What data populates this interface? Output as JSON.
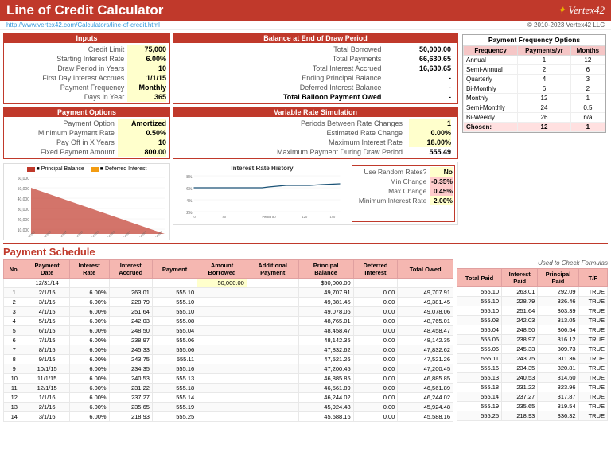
{
  "header": {
    "title": "Line of Credit Calculator",
    "link": "http://www.vertex42.com/Calculators/line-of-credit.html",
    "logo": "✦ Vertex42",
    "copyright": "© 2010-2023 Vertex42 LLC"
  },
  "inputs": {
    "title": "Inputs",
    "fields": [
      {
        "label": "Credit Limit",
        "value": "75,000"
      },
      {
        "label": "Starting Interest Rate",
        "value": "6.00%"
      },
      {
        "label": "Draw Period in Years",
        "value": "10"
      },
      {
        "label": "First Day Interest Accrues",
        "value": "1/1/15"
      },
      {
        "label": "Payment Frequency",
        "value": "Monthly"
      },
      {
        "label": "Days in Year",
        "value": "365"
      }
    ]
  },
  "balance": {
    "title": "Balance at End of Draw Period",
    "fields": [
      {
        "label": "Total Borrowed",
        "value": "50,000.00"
      },
      {
        "label": "Total Payments",
        "value": "66,630.65"
      },
      {
        "label": "Total Interest Accrued",
        "value": "16,630.65"
      },
      {
        "label": "Ending Principal Balance",
        "value": "-"
      },
      {
        "label": "Deferred Interest Balance",
        "value": "-"
      },
      {
        "label": "Total Balloon Payment Owed",
        "value": "-",
        "bold": true
      }
    ]
  },
  "paymentOptions": {
    "title": "Payment Options",
    "fields": [
      {
        "label": "Payment Option",
        "value": "Amortized"
      },
      {
        "label": "Minimum Payment Rate",
        "value": "0.50%"
      },
      {
        "label": "Pay Off in X Years",
        "value": "10"
      },
      {
        "label": "Fixed Payment Amount",
        "value": "800.00"
      }
    ]
  },
  "variableRate": {
    "title": "Variable Rate Simulation",
    "fields": [
      {
        "label": "Periods Between Rate Changes",
        "value": "1"
      },
      {
        "label": "Estimated Rate Change",
        "value": "0.00%"
      },
      {
        "label": "Maximum Interest Rate",
        "value": "18.00%"
      },
      {
        "label": "Maximum Payment During Draw Period",
        "value": "555.49"
      }
    ],
    "randomRates": [
      {
        "label": "Use Random Rates?",
        "value": "No"
      },
      {
        "label": "Min Change",
        "value": "-0.35%",
        "highlight": true
      },
      {
        "label": "Max Change",
        "value": "0.45%",
        "highlight": true
      },
      {
        "label": "Minimum Interest Rate",
        "value": "2.00%"
      }
    ]
  },
  "paymentFrequency": {
    "title": "Payment Frequency Options",
    "headers": [
      "Frequency",
      "Payments/yr",
      "Months"
    ],
    "rows": [
      {
        "frequency": "Annual",
        "payments": "1",
        "months": "12"
      },
      {
        "frequency": "Semi-Annual",
        "payments": "2",
        "months": "6"
      },
      {
        "frequency": "Quarterly",
        "payments": "4",
        "months": "3"
      },
      {
        "frequency": "Bi-Monthly",
        "payments": "6",
        "months": "2"
      },
      {
        "frequency": "Monthly",
        "payments": "12",
        "months": "1"
      },
      {
        "frequency": "Semi-Monthly",
        "payments": "24",
        "months": "0.5"
      },
      {
        "frequency": "Bi-Weekly",
        "payments": "26",
        "months": "n/a"
      },
      {
        "frequency": "Chosen:",
        "payments": "12",
        "months": "1",
        "chosen": true
      }
    ]
  },
  "chartLeft": {
    "yLabels": [
      "60,000",
      "50,000",
      "40,000",
      "30,000",
      "20,000",
      "10,000"
    ],
    "xLabels": [
      "2/10/2015",
      "2/10/2016",
      "2/10/2017",
      "2/10/2018",
      "2/10/2019",
      "2/10/2020",
      "2/10/2021",
      "2/10/2022",
      "2/10/2023",
      "2/10/2024"
    ],
    "legend": [
      "Principal Balance",
      "Deferred Interest"
    ]
  },
  "chartRight": {
    "title": "Interest Rate History",
    "yLabels": [
      "8%",
      "6%",
      "4%",
      "2%"
    ],
    "xLabel": "Period"
  },
  "schedule": {
    "title": "Payment Schedule",
    "headers": [
      "No.",
      "Payment\nDate",
      "Interest\nRate",
      "Interest\nAccrued",
      "Payment",
      "Amount\nBorrowed",
      "Additional\nPayment",
      "Principal\nBalance",
      "Deferred\nInterest",
      "Total Owed"
    ],
    "rows": [
      {
        "no": "",
        "date": "12/31/14",
        "rate": "",
        "accrued": "",
        "payment": "",
        "borrowed": "50,000.00",
        "additional": "",
        "principal": "$50,000.00",
        "deferred": "",
        "owed": ""
      },
      {
        "no": "1",
        "date": "2/1/15",
        "rate": "6.00%",
        "accrued": "263.01",
        "payment": "555.10",
        "borrowed": "",
        "additional": "",
        "principal": "49,707.91",
        "deferred": "0.00",
        "owed": "49,707.91"
      },
      {
        "no": "2",
        "date": "3/1/15",
        "rate": "6.00%",
        "accrued": "228.79",
        "payment": "555.10",
        "borrowed": "",
        "additional": "",
        "principal": "49,381.45",
        "deferred": "0.00",
        "owed": "49,381.45"
      },
      {
        "no": "3",
        "date": "4/1/15",
        "rate": "6.00%",
        "accrued": "251.64",
        "payment": "555.10",
        "borrowed": "",
        "additional": "",
        "principal": "49,078.06",
        "deferred": "0.00",
        "owed": "49,078.06"
      },
      {
        "no": "4",
        "date": "5/1/15",
        "rate": "6.00%",
        "accrued": "242.03",
        "payment": "555.08",
        "borrowed": "",
        "additional": "",
        "principal": "48,765.01",
        "deferred": "0.00",
        "owed": "48,765.01"
      },
      {
        "no": "5",
        "date": "6/1/15",
        "rate": "6.00%",
        "accrued": "248.50",
        "payment": "555.04",
        "borrowed": "",
        "additional": "",
        "principal": "48,458.47",
        "deferred": "0.00",
        "owed": "48,458.47"
      },
      {
        "no": "6",
        "date": "7/1/15",
        "rate": "6.00%",
        "accrued": "238.97",
        "payment": "555.06",
        "borrowed": "",
        "additional": "",
        "principal": "48,142.35",
        "deferred": "0.00",
        "owed": "48,142.35"
      },
      {
        "no": "7",
        "date": "8/1/15",
        "rate": "6.00%",
        "accrued": "245.33",
        "payment": "555.06",
        "borrowed": "",
        "additional": "",
        "principal": "47,832.62",
        "deferred": "0.00",
        "owed": "47,832.62"
      },
      {
        "no": "8",
        "date": "9/1/15",
        "rate": "6.00%",
        "accrued": "243.75",
        "payment": "555.11",
        "borrowed": "",
        "additional": "",
        "principal": "47,521.26",
        "deferred": "0.00",
        "owed": "47,521.26"
      },
      {
        "no": "9",
        "date": "10/1/15",
        "rate": "6.00%",
        "accrued": "234.35",
        "payment": "555.16",
        "borrowed": "",
        "additional": "",
        "principal": "47,200.45",
        "deferred": "0.00",
        "owed": "47,200.45"
      },
      {
        "no": "10",
        "date": "11/1/15",
        "rate": "6.00%",
        "accrued": "240.53",
        "payment": "555.13",
        "borrowed": "",
        "additional": "",
        "principal": "46,885.85",
        "deferred": "0.00",
        "owed": "46,885.85"
      },
      {
        "no": "11",
        "date": "12/1/15",
        "rate": "6.00%",
        "accrued": "231.22",
        "payment": "555.18",
        "borrowed": "",
        "additional": "",
        "principal": "46,561.89",
        "deferred": "0.00",
        "owed": "46,561.89"
      },
      {
        "no": "12",
        "date": "1/1/16",
        "rate": "6.00%",
        "accrued": "237.27",
        "payment": "555.14",
        "borrowed": "",
        "additional": "",
        "principal": "46,244.02",
        "deferred": "0.00",
        "owed": "46,244.02"
      },
      {
        "no": "13",
        "date": "2/1/16",
        "rate": "6.00%",
        "accrued": "235.65",
        "payment": "555.19",
        "borrowed": "",
        "additional": "",
        "principal": "45,924.48",
        "deferred": "0.00",
        "owed": "45,924.48"
      },
      {
        "no": "14",
        "date": "3/1/16",
        "rate": "6.00%",
        "accrued": "218.93",
        "payment": "555.25",
        "borrowed": "",
        "additional": "",
        "principal": "45,588.16",
        "deferred": "0.00",
        "owed": "45,588.16"
      }
    ]
  },
  "checkFormulas": {
    "title": "Used to Check Formulas",
    "headers": [
      "Total Paid",
      "Interest\nPaid",
      "Principal\nPaid",
      "T/F"
    ],
    "rows": [
      {
        "total": "555.10",
        "interest": "263.01",
        "principal": "292.09",
        "tf": "TRUE"
      },
      {
        "total": "555.10",
        "interest": "228.79",
        "principal": "326.46",
        "tf": "TRUE"
      },
      {
        "total": "555.10",
        "interest": "251.64",
        "principal": "303.39",
        "tf": "TRUE"
      },
      {
        "total": "555.08",
        "interest": "242.03",
        "principal": "313.05",
        "tf": "TRUE"
      },
      {
        "total": "555.04",
        "interest": "248.50",
        "principal": "306.54",
        "tf": "TRUE"
      },
      {
        "total": "555.06",
        "interest": "238.97",
        "principal": "316.12",
        "tf": "TRUE"
      },
      {
        "total": "555.06",
        "interest": "245.33",
        "principal": "309.73",
        "tf": "TRUE"
      },
      {
        "total": "555.11",
        "interest": "243.75",
        "principal": "311.36",
        "tf": "TRUE"
      },
      {
        "total": "555.16",
        "interest": "234.35",
        "principal": "320.81",
        "tf": "TRUE"
      },
      {
        "total": "555.13",
        "interest": "240.53",
        "principal": "314.60",
        "tf": "TRUE"
      },
      {
        "total": "555.18",
        "interest": "231.22",
        "principal": "323.96",
        "tf": "TRUE"
      },
      {
        "total": "555.14",
        "interest": "237.27",
        "principal": "317.87",
        "tf": "TRUE"
      },
      {
        "total": "555.19",
        "interest": "235.65",
        "principal": "319.54",
        "tf": "TRUE"
      },
      {
        "total": "555.25",
        "interest": "218.93",
        "principal": "336.32",
        "tf": "TRUE"
      }
    ]
  }
}
